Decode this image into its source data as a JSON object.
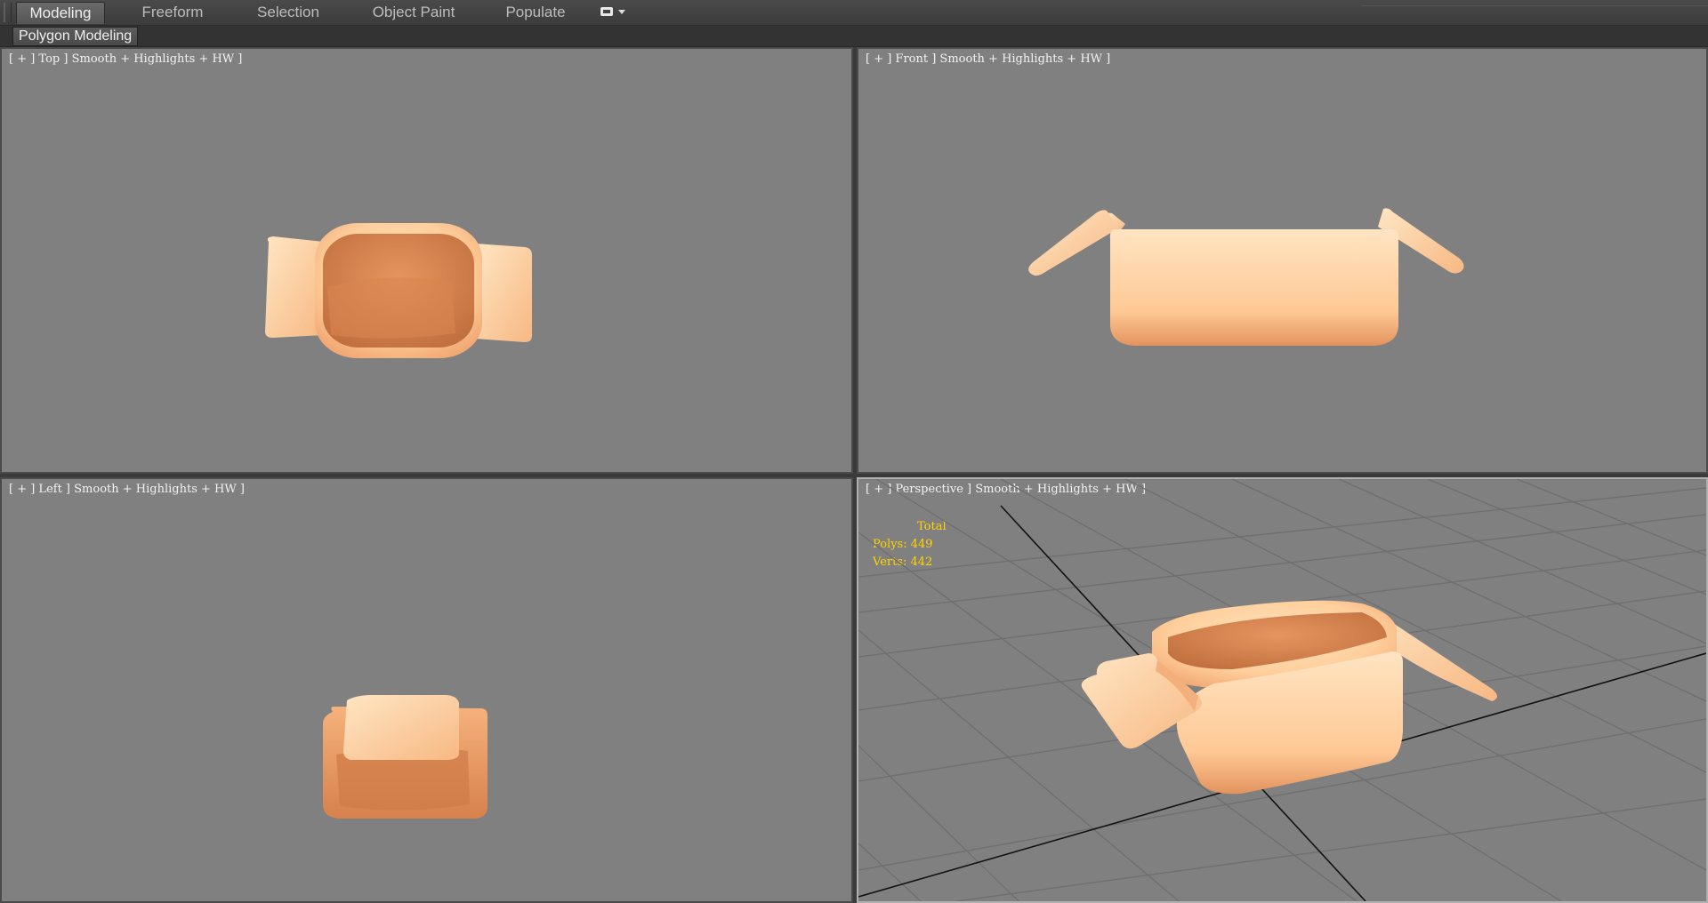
{
  "ribbon": {
    "tabs": [
      {
        "label": "Modeling",
        "active": true
      },
      {
        "label": "Freeform",
        "active": false
      },
      {
        "label": "Selection",
        "active": false
      },
      {
        "label": "Object Paint",
        "active": false
      },
      {
        "label": "Populate",
        "active": false
      }
    ],
    "options_icon": "ribbon-options-icon"
  },
  "subbar": {
    "panel_label": "Polygon Modeling"
  },
  "viewports": {
    "top": {
      "label": "[ + ] Top ] Smooth + Highlights + HW ]"
    },
    "front": {
      "label": "[ + ] Front ] Smooth + Highlights + HW ]"
    },
    "left": {
      "label": "[ + ] Left ] Smooth + Highlights + HW ]"
    },
    "perspective": {
      "label": "[ + ] Perspective ] Smooth + Highlights + HW ]",
      "stats": {
        "title": "Total",
        "polys": "Polys: 449",
        "verts": "Verts: 442"
      }
    }
  },
  "colors": {
    "viewport_bg": "#808080",
    "model_light": "#ffd4a3",
    "model_mid": "#f2a772",
    "model_dark": "#c96f3f",
    "stats_text": "#ffd400"
  }
}
